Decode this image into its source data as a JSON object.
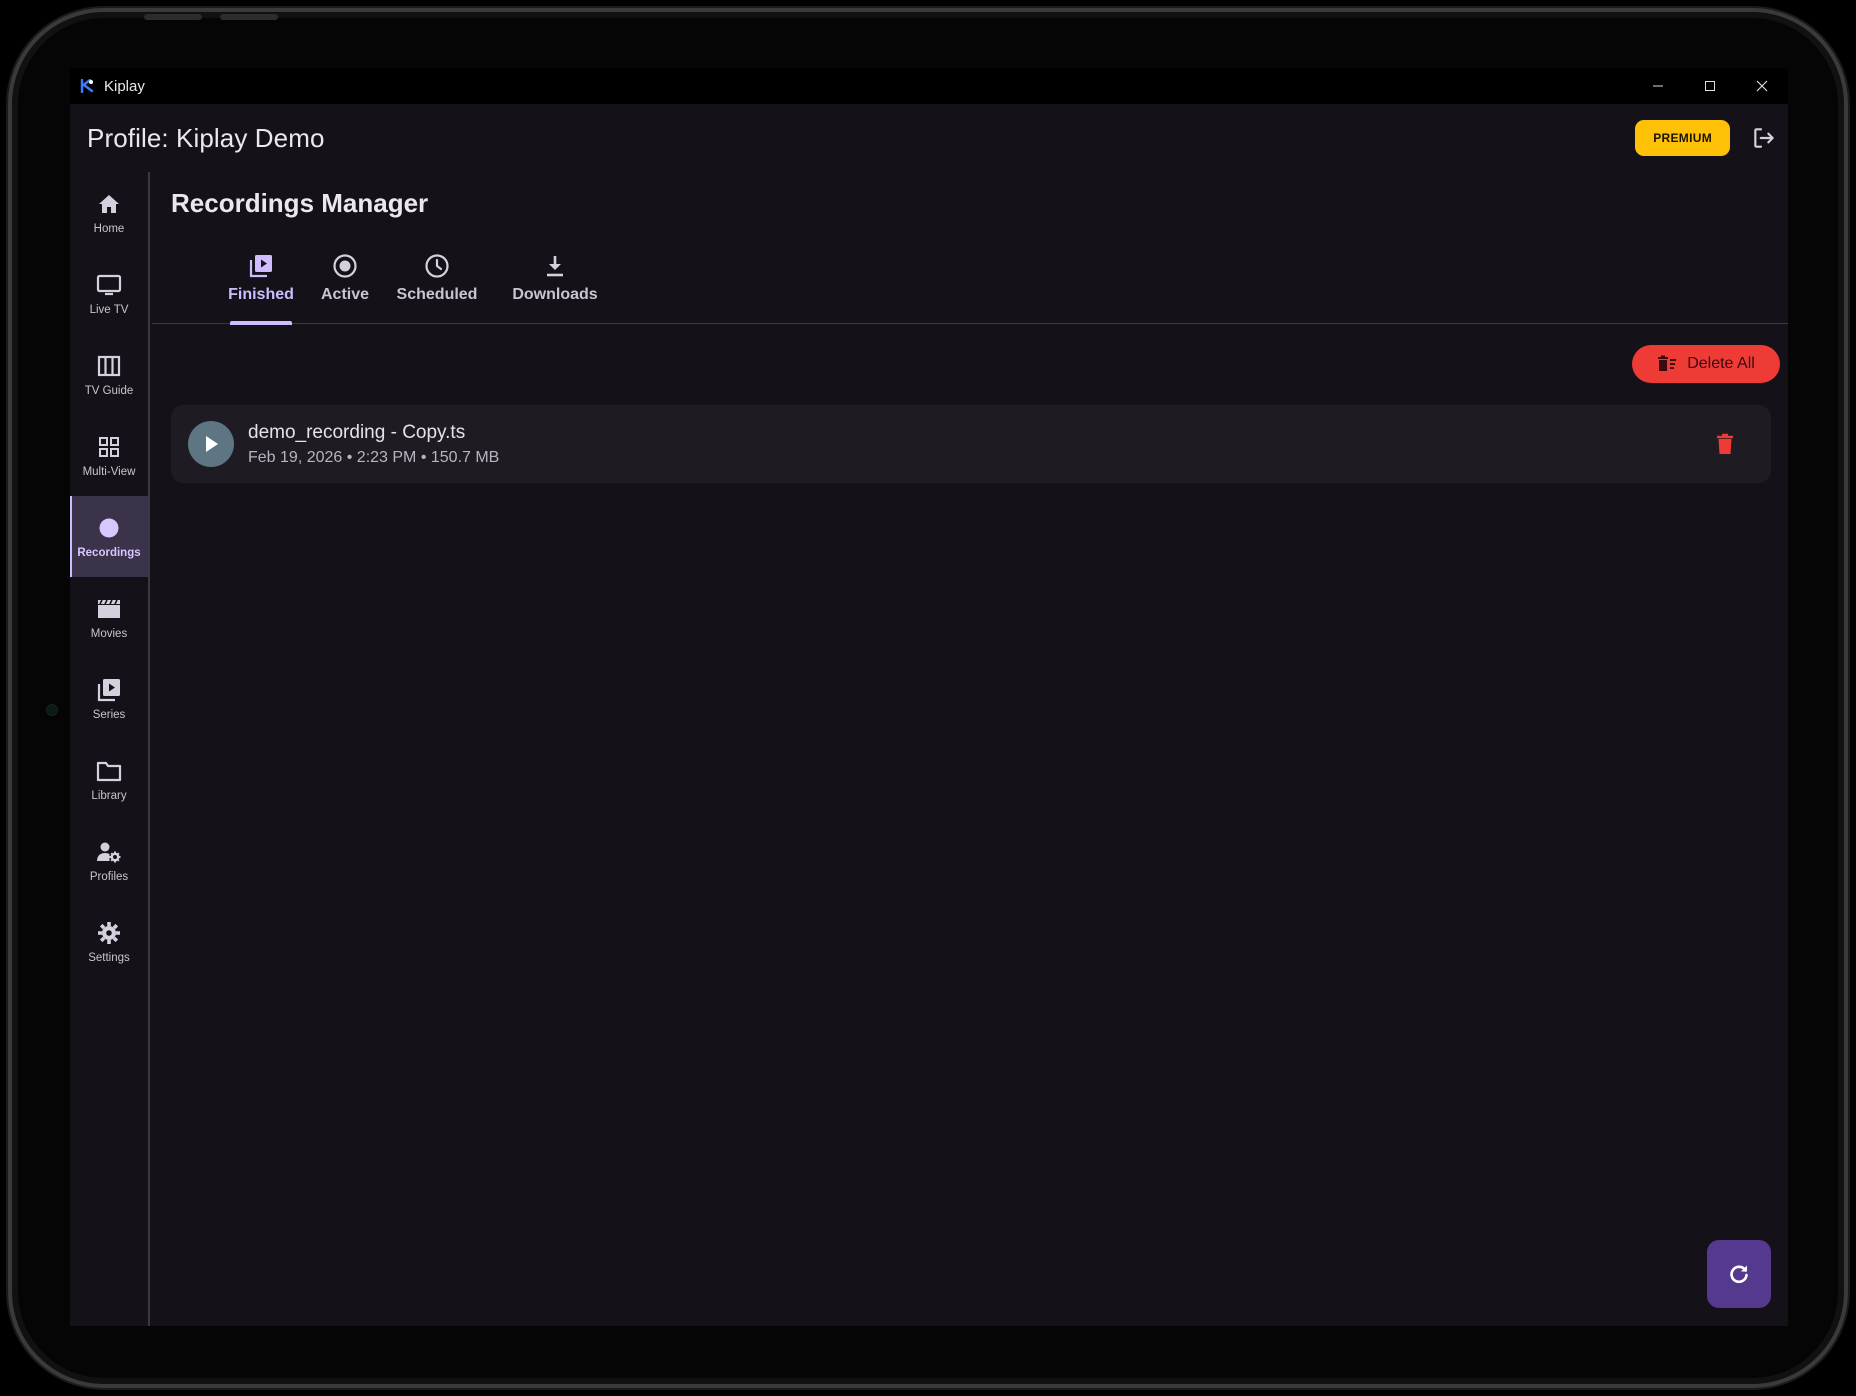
{
  "window": {
    "title": "Kiplay"
  },
  "appbar": {
    "profile_title": "Profile: Kiplay Demo",
    "premium_label": "PREMIUM",
    "logout_icon": "logout-icon"
  },
  "sidebar": {
    "items": [
      {
        "label": "Home",
        "icon": "home-icon",
        "active": false
      },
      {
        "label": "Live TV",
        "icon": "tv-icon",
        "active": false
      },
      {
        "label": "TV Guide",
        "icon": "guide-icon",
        "active": false
      },
      {
        "label": "Multi-View",
        "icon": "grid-icon",
        "active": false
      },
      {
        "label": "Recordings",
        "icon": "record-icon",
        "active": true
      },
      {
        "label": "Movies",
        "icon": "clapperboard-icon",
        "active": false
      },
      {
        "label": "Series",
        "icon": "series-icon",
        "active": false
      },
      {
        "label": "Library",
        "icon": "folder-icon",
        "active": false
      },
      {
        "label": "Profiles",
        "icon": "manage-accounts-icon",
        "active": false
      },
      {
        "label": "Settings",
        "icon": "gear-icon",
        "active": false
      }
    ]
  },
  "main": {
    "title": "Recordings Manager",
    "tabs": [
      {
        "label": "Finished",
        "icon": "video-library-icon",
        "active": true
      },
      {
        "label": "Active",
        "icon": "radio-button-icon",
        "active": false
      },
      {
        "label": "Scheduled",
        "icon": "clock-icon",
        "active": false
      },
      {
        "label": "Downloads",
        "icon": "download-icon",
        "active": false
      }
    ],
    "delete_all_label": "Delete All",
    "recordings": [
      {
        "name": "demo_recording - Copy.ts",
        "meta": "Feb 19, 2026 • 2:23 PM • 150.7 MB"
      }
    ],
    "refresh_icon": "refresh-icon"
  },
  "colors": {
    "background": "#141218",
    "accent": "#cfbcff",
    "premium": "#ffc107",
    "danger": "#ef3b36",
    "fab": "#55398f"
  }
}
